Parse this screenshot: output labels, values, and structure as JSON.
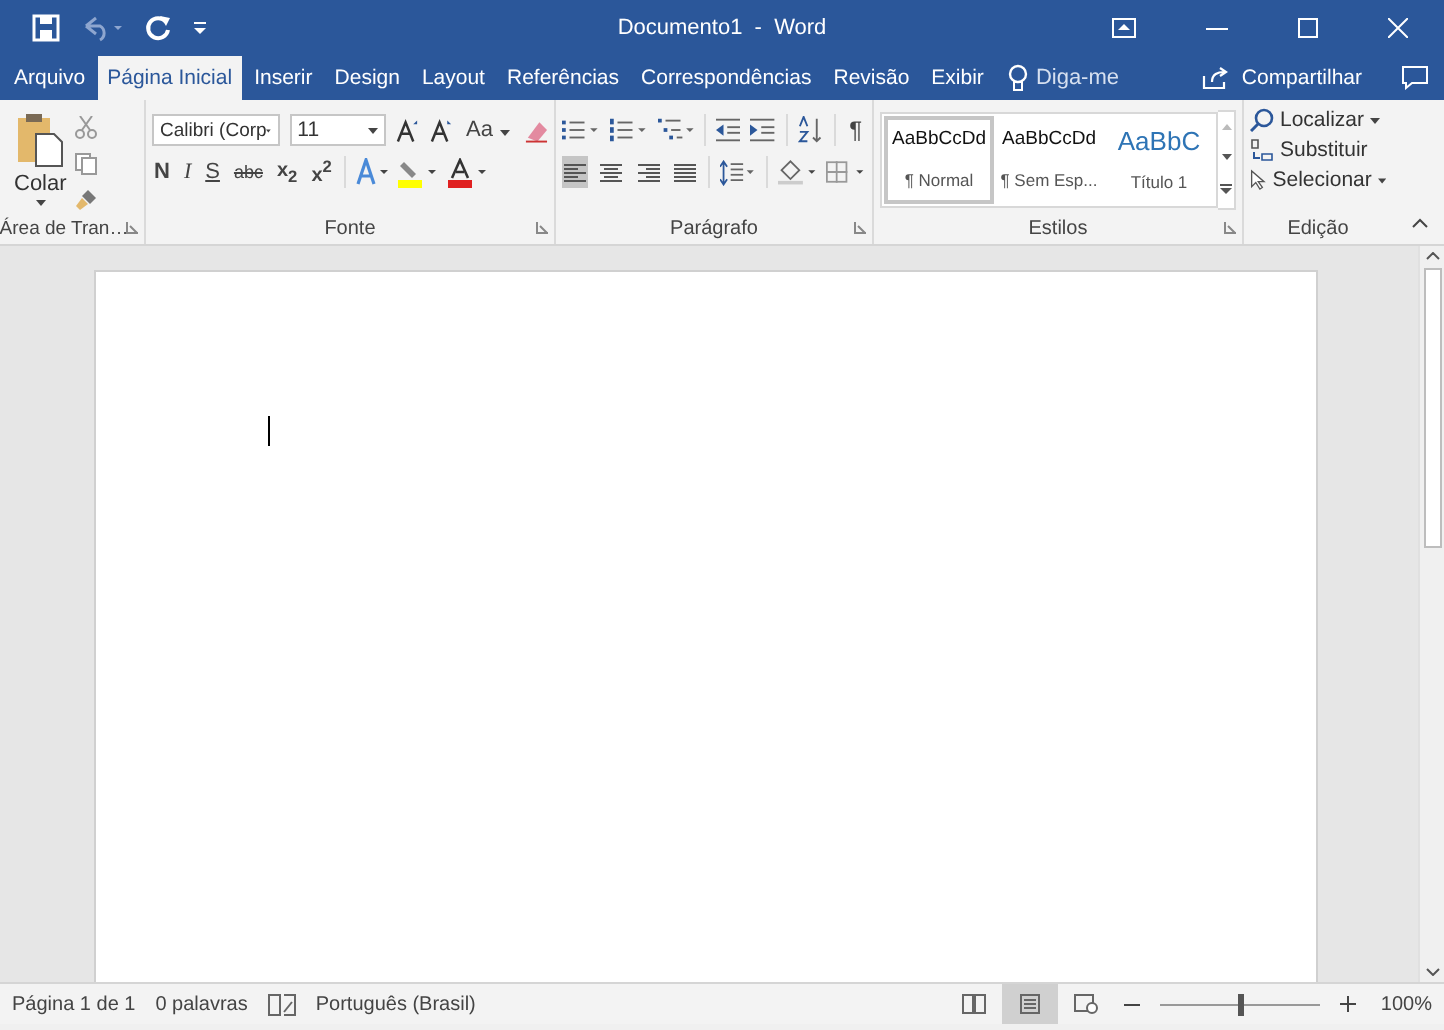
{
  "window": {
    "title": "Documento1  -  Word"
  },
  "tabs": [
    {
      "label": "Arquivo",
      "selected": false
    },
    {
      "label": "Página Inicial",
      "selected": true
    },
    {
      "label": "Inserir",
      "selected": false
    },
    {
      "label": "Design",
      "selected": false
    },
    {
      "label": "Layout",
      "selected": false
    },
    {
      "label": "Referências",
      "selected": false
    },
    {
      "label": "Correspondências",
      "selected": false
    },
    {
      "label": "Revisão",
      "selected": false
    },
    {
      "label": "Exibir",
      "selected": false
    }
  ],
  "tell_me": {
    "placeholder": "Diga-me"
  },
  "share": {
    "label": "Compartilhar"
  },
  "clipboard": {
    "paste": "Colar",
    "caption": "Área de Tran…"
  },
  "font": {
    "name": "Calibri (Corp",
    "size": "11",
    "case_button": "Aa",
    "caption": "Fonte",
    "format_buttons": [
      {
        "label": "N",
        "kind": "bold"
      },
      {
        "label": "I",
        "kind": "italic"
      },
      {
        "label": "S",
        "kind": "underline"
      },
      {
        "label": "abc",
        "kind": "strike"
      },
      {
        "label": "x$_{2}$",
        "kind": "script"
      },
      {
        "label": "x$^{2}$",
        "kind": "script"
      }
    ]
  },
  "paragraph": {
    "caption": "Parágrafo",
    "pilcrow": "¶",
    "alignment": [
      {
        "selected": true
      },
      {
        "selected": false
      },
      {
        "selected": false
      },
      {
        "selected": false
      }
    ]
  },
  "styles": {
    "caption": "Estilos",
    "items": [
      {
        "preview": "AaBbCcDd",
        "name": "¶ Normal",
        "kind": "body",
        "selected": true
      },
      {
        "preview": "AaBbCcDd",
        "name": "¶ Sem Esp...",
        "kind": "body",
        "selected": false
      },
      {
        "preview": "AaBbC",
        "name": "Título 1",
        "kind": "heading",
        "selected": false
      }
    ]
  },
  "editing": {
    "caption": "Edição",
    "find": "Localizar",
    "replace": "Substituir",
    "select": "Selecionar"
  },
  "status_bar": {
    "page": "Página 1 de 1",
    "words": "0 palavras",
    "language": "Português (Brasil)",
    "views": [
      {
        "selected": false
      },
      {
        "selected": true
      },
      {
        "selected": false
      }
    ],
    "zoom": {
      "level": 0.5,
      "reading": "100%"
    }
  }
}
